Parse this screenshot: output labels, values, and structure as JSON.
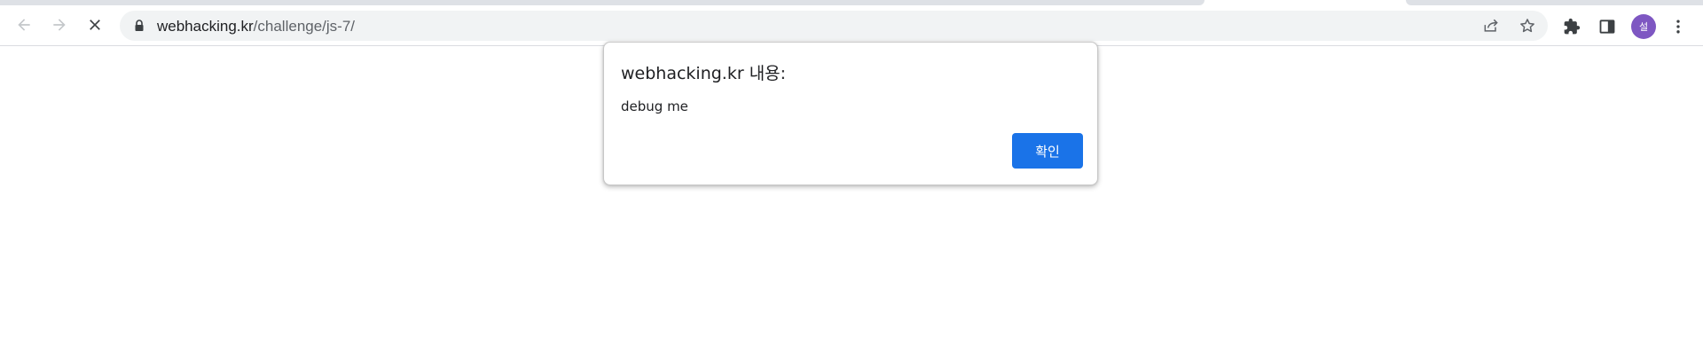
{
  "browser": {
    "url_host": "webhacking.kr",
    "url_path": "/challenge/js-7/",
    "avatar_initial": "설",
    "icons": {
      "back": "back-arrow-icon",
      "forward": "forward-arrow-icon",
      "stop": "stop-loading-icon",
      "lock": "lock-icon",
      "share": "share-icon",
      "bookmark": "star-icon",
      "extensions": "puzzle-icon",
      "side_panel": "side-panel-icon",
      "menu": "kebab-menu-icon"
    },
    "colors": {
      "avatar": "#7e57c2",
      "omnibox": "#f1f3f4"
    }
  },
  "dialog": {
    "title": "webhacking.kr 내용:",
    "message": "debug me",
    "ok_label": "확인",
    "ok_color": "#1a73e8"
  }
}
